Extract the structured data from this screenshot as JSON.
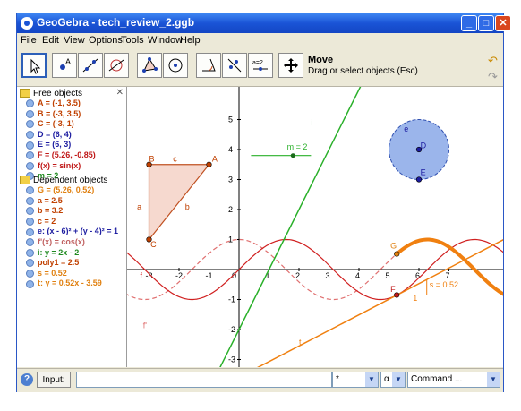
{
  "window": {
    "title": "GeoGebra - tech_review_2.ggb"
  },
  "menu": [
    "File",
    "Edit",
    "View",
    "Options",
    "Tools",
    "Window",
    "Help"
  ],
  "toolbar": {
    "active_tool_title": "Move",
    "active_tool_help": "Drag or select objects (Esc)",
    "slider_tool_label": "a=2",
    "tools": [
      "move-tool",
      "point-tool",
      "line-tool",
      "polygon-tool",
      "triangle-tool",
      "circle-tool",
      "angle-tool",
      "reflect-tool",
      "slider-tool",
      "move-view-tool"
    ]
  },
  "algebra": {
    "free_header": "Free objects",
    "dependent_header": "Dependent objects",
    "free": [
      {
        "text": "A = (-1, 3.5)",
        "color": "#c04000"
      },
      {
        "text": "B = (-3, 3.5)",
        "color": "#c04000"
      },
      {
        "text": "C = (-3, 1)",
        "color": "#c04000"
      },
      {
        "text": "D = (6, 4)",
        "color": "#1c1ca0"
      },
      {
        "text": "E = (6, 3)",
        "color": "#1c1ca0"
      },
      {
        "text": "F = (5.26, -0.85)",
        "color": "#c01818"
      },
      {
        "text": "f(x) = sin(x)",
        "color": "#c01818"
      },
      {
        "text": "m = 2",
        "color": "#208a20"
      }
    ],
    "dependent": [
      {
        "text": "G = (5.26, 0.52)",
        "color": "#e08010"
      },
      {
        "text": "a = 2.5",
        "color": "#c04000"
      },
      {
        "text": "b = 3.2",
        "color": "#c04000"
      },
      {
        "text": "c = 2",
        "color": "#c04000"
      },
      {
        "text": "e: (x - 6)² + (y - 4)² = 1",
        "color": "#1c1ca0"
      },
      {
        "text": "f'(x) = cos(x)",
        "color": "#c06060"
      },
      {
        "text": "i: y = 2x - 2",
        "color": "#208a20"
      },
      {
        "text": "poly1 = 2.5",
        "color": "#c04000"
      },
      {
        "text": "s = 0.52",
        "color": "#e08010"
      },
      {
        "text": "t: y = 0.52x - 3.59",
        "color": "#e08010"
      }
    ]
  },
  "graphics": {
    "x_ticks": [
      "-3",
      "-2",
      "-1",
      "0",
      "1",
      "2",
      "3",
      "4",
      "5",
      "6",
      "7"
    ],
    "y_ticks": [
      "5",
      "4",
      "3",
      "2",
      "1",
      "-1",
      "-2",
      "-3"
    ],
    "labels": {
      "A": "A",
      "B": "B",
      "C": "C",
      "D": "D",
      "E": "E",
      "F": "F",
      "G": "G",
      "a": "a",
      "b": "b",
      "c": "c",
      "e": "e",
      "f": "f",
      "fprime": "f'",
      "i": "i",
      "t": "t",
      "slope_one": "1",
      "slope_s": "s = 0.52",
      "slider": "m = 2"
    },
    "colors": {
      "sin": "#d02020",
      "cos": "#e07070",
      "line_i": "#2ab02a",
      "tangent": "#f08010",
      "triangle_fill": "#f6d9cf",
      "triangle_stroke": "#c05020",
      "circle_fill": "#8aa8e8",
      "circle_stroke": "#3050b0",
      "axis": "#000000"
    }
  },
  "inputbar": {
    "help": "?",
    "input_label": "Input:",
    "input_value": "",
    "symbol_combo": "*",
    "greek_combo": "α",
    "command_combo": "Command ..."
  }
}
